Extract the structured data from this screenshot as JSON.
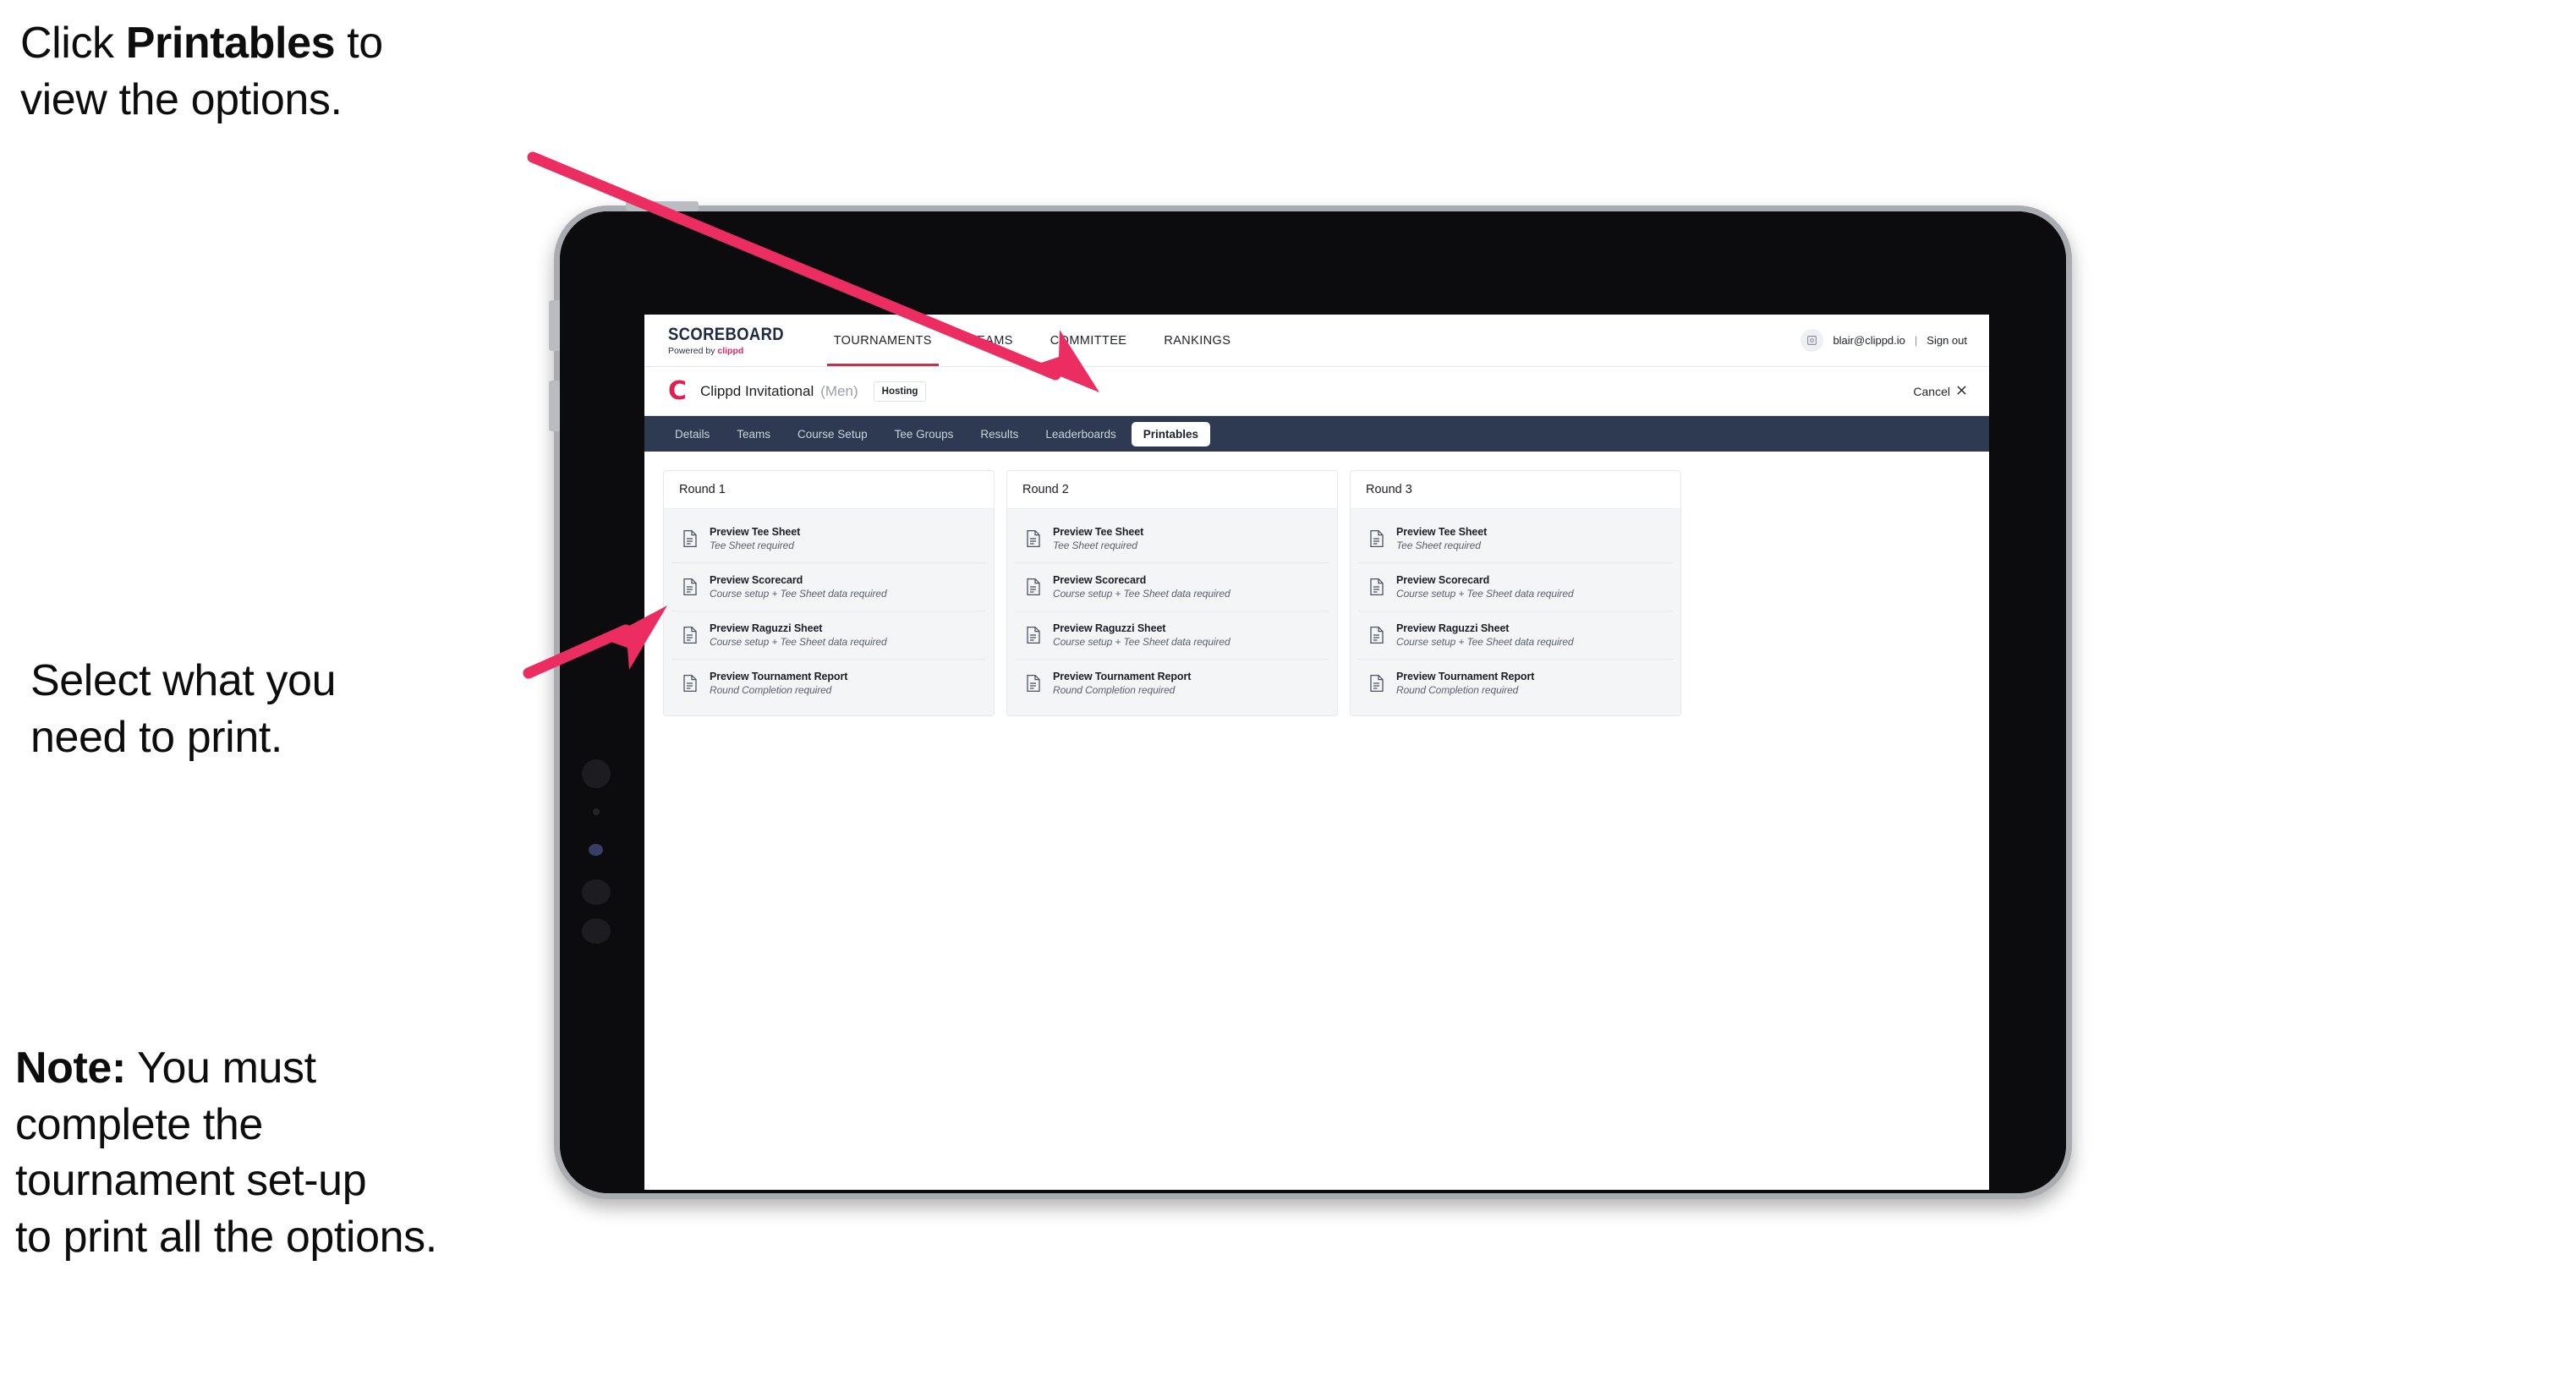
{
  "annotations": {
    "click_printables": {
      "prefix": "Click ",
      "bold": "Printables",
      "suffix": " to\nview the options."
    },
    "select_print": "Select what you\n need to print.",
    "note": {
      "bold": "Note:",
      "text": " You must\ncomplete the\ntournament set-up\nto print all the options."
    },
    "arrow_color": "#ec2d61"
  },
  "app": {
    "brand": {
      "title": "SCOREBOARD",
      "powered_prefix": "Powered by ",
      "powered_name": "clippd"
    },
    "topnav": {
      "links": [
        {
          "label": "TOURNAMENTS",
          "active": true
        },
        {
          "label": "TEAMS",
          "active": false
        },
        {
          "label": "COMMITTEE",
          "active": false
        },
        {
          "label": "RANKINGS",
          "active": false
        }
      ],
      "avatar_icon": "user-avatar-icon",
      "user_email": "blair@clippd.io",
      "divider": "|",
      "sign_out": "Sign out"
    },
    "tournament_header": {
      "logo_glyph": "C",
      "name": "Clippd Invitational",
      "gender": "(Men)",
      "status_badge": "Hosting",
      "cancel_label": "Cancel",
      "cancel_icon": "close-icon"
    },
    "tabs": [
      {
        "label": "Details",
        "active": false
      },
      {
        "label": "Teams",
        "active": false
      },
      {
        "label": "Course Setup",
        "active": false
      },
      {
        "label": "Tee Groups",
        "active": false
      },
      {
        "label": "Results",
        "active": false
      },
      {
        "label": "Leaderboards",
        "active": false
      },
      {
        "label": "Printables",
        "active": true
      }
    ],
    "rounds": [
      {
        "title": "Round 1",
        "items": [
          {
            "title": "Preview Tee Sheet",
            "subtitle": "Tee Sheet required"
          },
          {
            "title": "Preview Scorecard",
            "subtitle": "Course setup + Tee Sheet data required"
          },
          {
            "title": "Preview Raguzzi Sheet",
            "subtitle": "Course setup + Tee Sheet data required"
          },
          {
            "title": "Preview Tournament Report",
            "subtitle": "Round Completion required"
          }
        ]
      },
      {
        "title": "Round 2",
        "items": [
          {
            "title": "Preview Tee Sheet",
            "subtitle": "Tee Sheet required"
          },
          {
            "title": "Preview Scorecard",
            "subtitle": "Course setup + Tee Sheet data required"
          },
          {
            "title": "Preview Raguzzi Sheet",
            "subtitle": "Course setup + Tee Sheet data required"
          },
          {
            "title": "Preview Tournament Report",
            "subtitle": "Round Completion required"
          }
        ]
      },
      {
        "title": "Round 3",
        "items": [
          {
            "title": "Preview Tee Sheet",
            "subtitle": "Tee Sheet required"
          },
          {
            "title": "Preview Scorecard",
            "subtitle": "Course setup + Tee Sheet data required"
          },
          {
            "title": "Preview Raguzzi Sheet",
            "subtitle": "Course setup + Tee Sheet data required"
          },
          {
            "title": "Preview Tournament Report",
            "subtitle": "Round Completion required"
          }
        ]
      }
    ],
    "colors": {
      "accent_pink": "#e0204e",
      "tabstrip_navy": "#2e3a51",
      "active_underline": "#b33a52"
    }
  }
}
